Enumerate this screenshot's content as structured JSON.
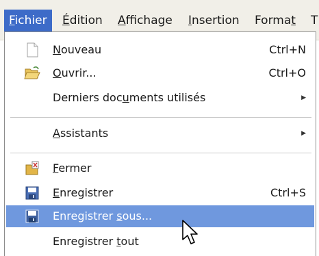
{
  "menubar": {
    "items": [
      {
        "mn": "F",
        "rest": "ichier"
      },
      {
        "mn": "É",
        "rest": "dition"
      },
      {
        "mn": "A",
        "rest": "ffichage"
      },
      {
        "mn": "I",
        "rest": "nsertion"
      },
      {
        "pre": "Forma",
        "mn": "t"
      },
      {
        "rest": "T"
      }
    ]
  },
  "file_menu": {
    "new": {
      "mn": "N",
      "rest": "ouveau",
      "shortcut": "Ctrl+N",
      "icon": "new-document-icon"
    },
    "open": {
      "mn": "O",
      "rest": "uvrir...",
      "shortcut": "Ctrl+O",
      "icon": "open-folder-icon"
    },
    "recent": {
      "pre": "Derniers doc",
      "mn": "u",
      "rest": "ments utilisés"
    },
    "wizards": {
      "mn": "A",
      "rest": "ssistants"
    },
    "close": {
      "mn": "F",
      "rest": "ermer",
      "icon": "close-document-icon"
    },
    "save": {
      "mn": "E",
      "rest": "nregistrer",
      "shortcut": "Ctrl+S",
      "icon": "save-disk-icon"
    },
    "save_as": {
      "pre": "Enregistrer ",
      "mn": "s",
      "rest": "ous...",
      "icon": "save-as-disk-icon"
    },
    "save_all": {
      "pre": "Enregistrer ",
      "mn": "t",
      "rest": "out"
    }
  },
  "colors": {
    "menu_active": "#3d6bc8",
    "row_highlight": "#6f98de",
    "menubar_bg": "#f1efe8"
  }
}
